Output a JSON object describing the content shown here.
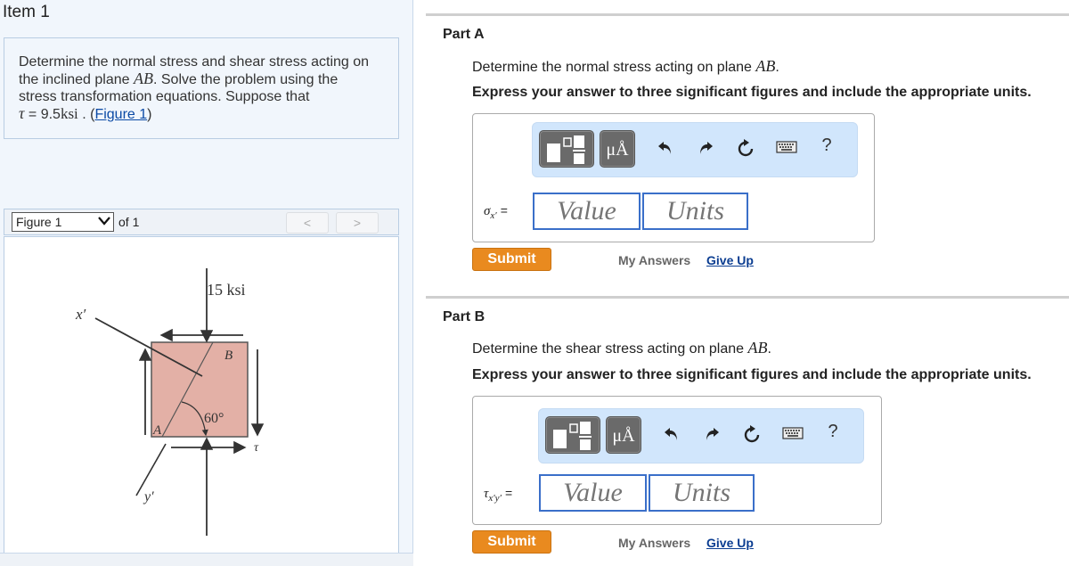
{
  "item": {
    "title": "Item 1"
  },
  "problem": {
    "line1": "Determine the normal stress and shear stress acting on",
    "line2_pre": "the inclined plane ",
    "plane": "AB",
    "line2_post": ". Solve the problem using the",
    "line3": "stress transformation equations. Suppose that",
    "tau_symbol": "τ",
    "equals": " = ",
    "tau_value": "9.5",
    "tau_unit": "ksi",
    "sep": " . (",
    "figure_link": "Figure 1",
    "close": ")"
  },
  "figure_nav": {
    "selected": "Figure 1",
    "of_label": "of 1",
    "prev": "<",
    "next": ">"
  },
  "figure": {
    "load_label": "15 ksi",
    "point_a": "A",
    "point_b": "B",
    "angle": "60°",
    "x_axis": "x′",
    "y_axis": "y′",
    "tau_label": "τ",
    "block_color": "#e3b0a6"
  },
  "toolbar": {
    "templates_icon": "templates-icon",
    "units_label": "μÅ",
    "undo": "↶",
    "redo": "↷",
    "reset": "↻",
    "keyboard": "⌨",
    "help": "?"
  },
  "parts": [
    {
      "title": "Part A",
      "question_pre": "Determine the normal stress acting on plane ",
      "plane": "AB",
      "question_post": ".",
      "instruction": "Express your answer to three significant figures and include the appropriate units.",
      "symbol": "σ",
      "subscript": "x′",
      "equals": "=",
      "value_placeholder": "Value",
      "units_placeholder": "Units",
      "submit": "Submit",
      "my_answers": "My Answers",
      "give_up": "Give Up"
    },
    {
      "title": "Part B",
      "question_pre": "Determine the shear stress acting on plane ",
      "plane": "AB",
      "question_post": ".",
      "instruction": "Express your answer to three significant figures and include the appropriate units.",
      "symbol": "τ",
      "subscript": "x′y′",
      "equals": "=",
      "value_placeholder": "Value",
      "units_placeholder": "Units",
      "submit": "Submit",
      "my_answers": "My Answers",
      "give_up": "Give Up"
    }
  ],
  "colors": {
    "submit": "#e98a1f",
    "link": "#0b4aa5",
    "toolbar_bg": "#d1e6fc",
    "input_border": "#3a6fc9"
  }
}
